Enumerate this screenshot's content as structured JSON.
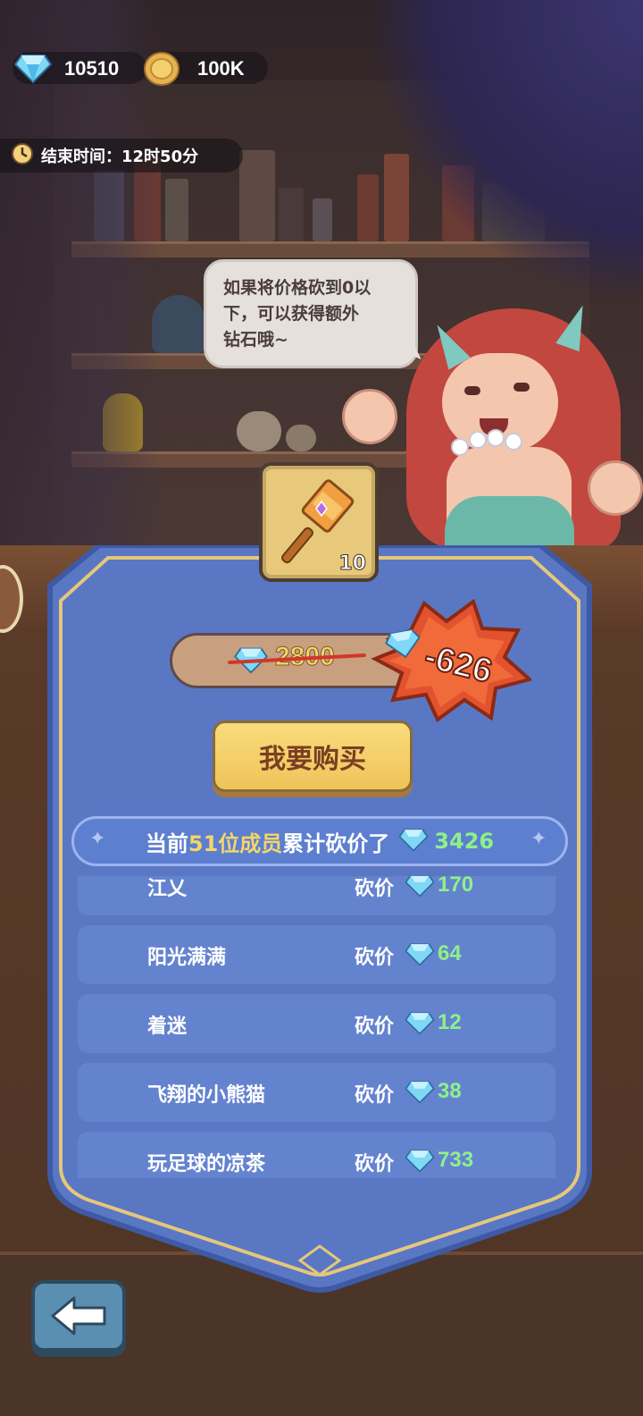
{
  "currency": {
    "diamonds": "10510",
    "coins": "100K"
  },
  "timer": {
    "text": "结束时间：12时50分"
  },
  "npc": {
    "speech_line1": "如果将价格砍到0以",
    "speech_line2": "下，可以获得额外",
    "speech_line3": "钻石哦~"
  },
  "item": {
    "icon": "hammer-icon",
    "count": "10"
  },
  "price": {
    "original": "2800",
    "discount": "-626"
  },
  "buy_button": {
    "label": "我要购买"
  },
  "summary": {
    "prefix": "当前",
    "members": "51位成员",
    "suffix": "累计砍价了",
    "total": "3426"
  },
  "contributors": [
    {
      "name": "江乂",
      "action": "砍价",
      "value": "170"
    },
    {
      "name": "阳光满满",
      "action": "砍价",
      "value": "64"
    },
    {
      "name": "着迷",
      "action": "砍价",
      "value": "12"
    },
    {
      "name": "飞翔的小熊猫",
      "action": "砍价",
      "value": "38"
    },
    {
      "name": "玩足球的凉茶",
      "action": "砍价",
      "value": "733"
    }
  ],
  "back_button": {
    "icon": "arrow-left-icon"
  },
  "colors": {
    "panel_blue": "#5a77c4",
    "gold_accent": "#f5d56b",
    "value_green": "#8ff08a",
    "discount_red": "#e2522f"
  }
}
